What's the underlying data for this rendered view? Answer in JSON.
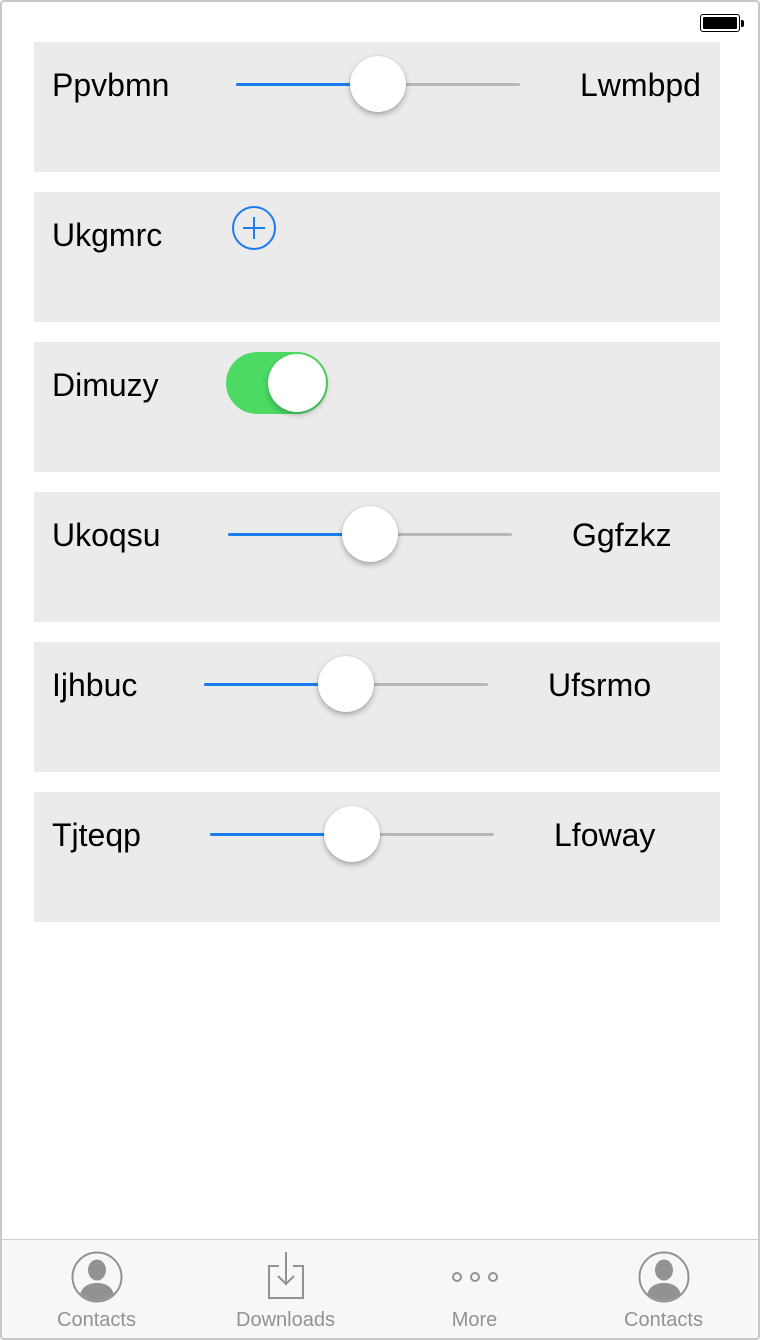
{
  "rows": [
    {
      "type": "slider",
      "label": "Ppvbmn",
      "right_label": "Lwmbpd",
      "value": 0.5
    },
    {
      "type": "add",
      "label": "Ukgmrc"
    },
    {
      "type": "toggle",
      "label": "Dimuzy",
      "on": true
    },
    {
      "type": "slider",
      "label": "Ukoqsu",
      "right_label": "Ggfzkz",
      "value": 0.5
    },
    {
      "type": "slider",
      "label": "Ijhbuc",
      "right_label": "Ufsrmo",
      "value": 0.5
    },
    {
      "type": "slider",
      "label": "Tjteqp",
      "right_label": "Lfoway",
      "value": 0.5
    }
  ],
  "tabs": [
    {
      "label": "Contacts",
      "icon": "contacts-icon"
    },
    {
      "label": "Downloads",
      "icon": "downloads-icon"
    },
    {
      "label": "More",
      "icon": "more-icon"
    },
    {
      "label": "Contacts",
      "icon": "contacts-icon"
    }
  ],
  "colors": {
    "accent": "#1a7cf0",
    "toggle_on": "#4cd964",
    "row_bg": "#ebebeb",
    "tab_inactive": "#929292"
  }
}
